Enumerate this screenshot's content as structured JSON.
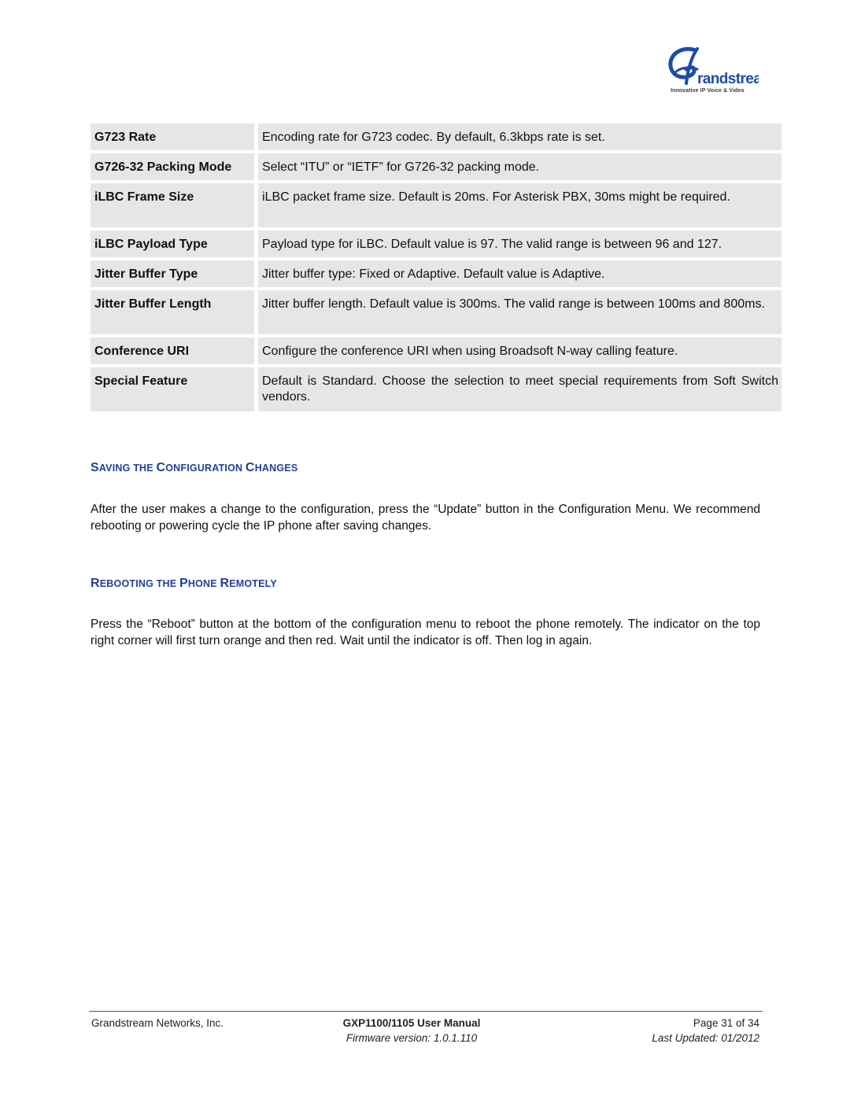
{
  "header": {
    "logo": {
      "brand": "Grandstream",
      "tagline": "Innovative IP Voice & Video",
      "colors": {
        "primary": "#1f4aa8",
        "dark": "#1a3a8c"
      }
    }
  },
  "parameter_table": {
    "rows": [
      {
        "name": "G723 Rate",
        "description": "Encoding rate for G723 codec. By default, 6.3kbps rate is set."
      },
      {
        "name": "G726-32 Packing Mode",
        "description": "Select “ITU” or “IETF” for G726-32 packing mode."
      },
      {
        "name": "iLBC Frame Size",
        "description": "iLBC packet frame size. Default is 20ms. For Asterisk PBX, 30ms might be required."
      },
      {
        "name": "iLBC Payload Type",
        "description": "Payload type for iLBC. Default value is 97. The valid range is between 96 and 127."
      },
      {
        "name": "Jitter Buffer Type",
        "description": "Jitter buffer type: Fixed or Adaptive. Default value is Adaptive."
      },
      {
        "name": "Jitter Buffer Length",
        "description": "Jitter buffer length. Default value is 300ms. The valid range is between 100ms and 800ms."
      },
      {
        "name": "Conference URI",
        "description": "Configure the conference URI when using Broadsoft N-way calling feature."
      },
      {
        "name": "Special Feature",
        "description": "Default is Standard. Choose the selection to meet special requirements from Soft Switch vendors."
      }
    ],
    "cell_background": "#e6e6e6"
  },
  "sections": [
    {
      "heading": "Saving the Configuration Changes",
      "heading_parts": [
        "S",
        "AVING THE ",
        "C",
        "ONFIGURATION ",
        "C",
        "HANGES"
      ],
      "body": "After the user makes a change to the configuration, press the “Update” button in the Configuration Menu. We recommend rebooting or powering cycle the IP phone after saving changes."
    },
    {
      "heading": "Rebooting the Phone Remotely",
      "heading_parts": [
        "R",
        "EBOOTING THE ",
        "P",
        "HONE ",
        "R",
        "EMOTELY"
      ],
      "body": "Press the “Reboot” button at the bottom of the configuration menu to reboot the phone remotely. The indicator on the top right corner will first turn orange and then red. Wait until the indicator is off. Then log in again."
    }
  ],
  "heading_color": "#1f3f9f",
  "footer": {
    "company": "Grandstream Networks, Inc.",
    "manual_title": "GXP1100/1105 User Manual",
    "firmware": "Firmware version: 1.0.1.110",
    "page": "Page 31 of 34",
    "last_updated": "Last Updated:  01/2012"
  }
}
